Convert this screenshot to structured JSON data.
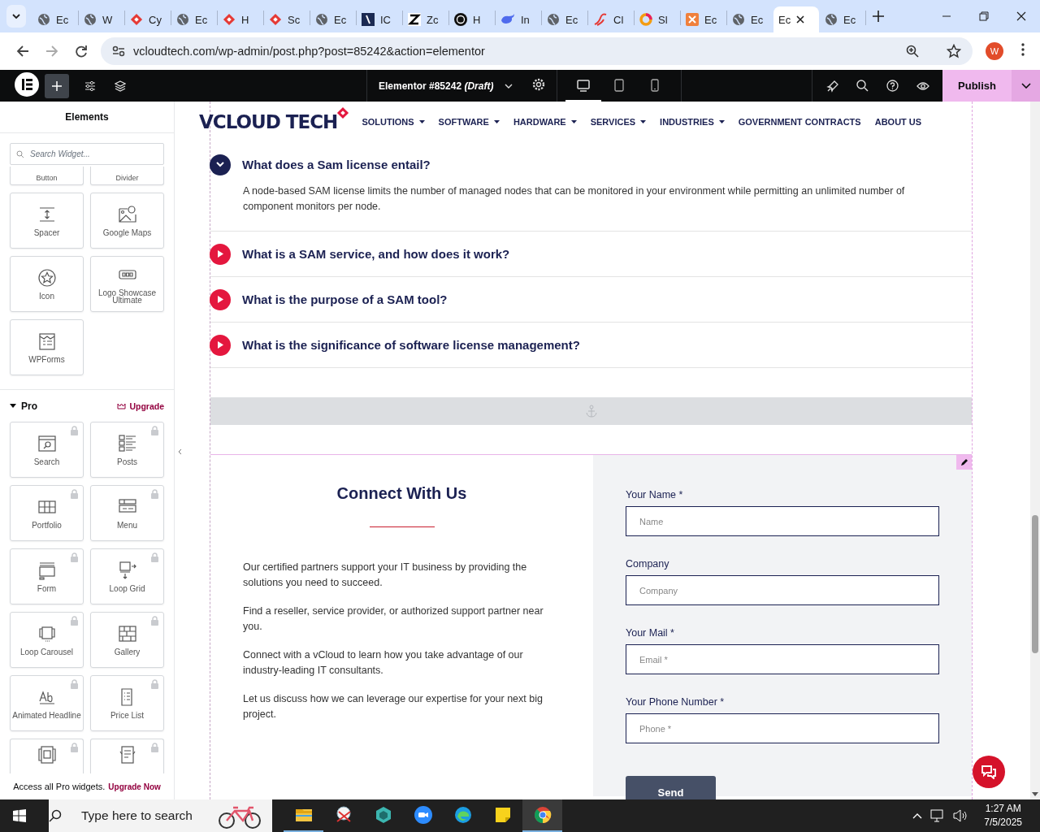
{
  "browser": {
    "tabs": [
      {
        "label": "Ec",
        "kind": "globe",
        "selected": false
      },
      {
        "label": "W",
        "kind": "globe",
        "selected": false
      },
      {
        "label": "Cy",
        "kind": "diamond",
        "selected": false
      },
      {
        "label": "Ec",
        "kind": "globe",
        "selected": false
      },
      {
        "label": "H",
        "kind": "diamond",
        "selected": false
      },
      {
        "label": "Sc",
        "kind": "diamond",
        "selected": false
      },
      {
        "label": "Ec",
        "kind": "globe",
        "selected": false
      },
      {
        "label": "IC",
        "kind": "slash",
        "selected": false
      },
      {
        "label": "Zc",
        "kind": "zed",
        "selected": false
      },
      {
        "label": "H",
        "kind": "dark",
        "selected": false
      },
      {
        "label": "In",
        "kind": "whale",
        "selected": false
      },
      {
        "label": "Ec",
        "kind": "globe",
        "selected": false
      },
      {
        "label": "Cl",
        "kind": "swirl",
        "selected": false
      },
      {
        "label": "Sl",
        "kind": "ring",
        "selected": false
      },
      {
        "label": "Ec",
        "kind": "box",
        "selected": false
      },
      {
        "label": "Ec",
        "kind": "globe",
        "selected": false
      },
      {
        "label": "Ec",
        "kind": "none",
        "selected": true
      },
      {
        "label": "Ec",
        "kind": "globe",
        "selected": false
      }
    ],
    "address": "vcloudtech.com/wp-admin/post.php?post=85242&action=elementor",
    "profile": "W"
  },
  "editor_bar": {
    "title": "Elementor #85242 *(Draft)*",
    "devices": [
      {
        "kind": "desktop",
        "selected": true
      },
      {
        "kind": "tablet",
        "selected": false
      },
      {
        "kind": "mobile",
        "selected": false
      }
    ],
    "publish": "Publish"
  },
  "panel": {
    "title": "Elements",
    "search": {
      "placeholder": "Search Widget..."
    },
    "widgets": [
      {
        "label": "Button",
        "kind": "stub"
      },
      {
        "label": "Divider",
        "kind": "stub"
      },
      {
        "label": "Spacer",
        "kind": "spacer"
      },
      {
        "label": "Google Maps",
        "kind": "map"
      },
      {
        "label": "Icon",
        "kind": "star"
      },
      {
        "label": "Logo Showcase Ultimate",
        "kind": "logos"
      },
      {
        "label": "WPForms",
        "kind": "wpforms"
      }
    ],
    "pro": {
      "title": "Pro",
      "expanded": true,
      "upgrade": "Upgrade",
      "widgets": [
        {
          "label": "Search",
          "kind": "search",
          "locked": true
        },
        {
          "label": "Posts",
          "kind": "posts",
          "locked": true
        },
        {
          "label": "Portfolio",
          "kind": "portfolio",
          "locked": true
        },
        {
          "label": "Menu",
          "kind": "menu",
          "locked": true
        },
        {
          "label": "Form",
          "kind": "form",
          "locked": true
        },
        {
          "label": "Loop Grid",
          "kind": "loopgrid",
          "locked": true
        },
        {
          "label": "Loop Carousel",
          "kind": "carousel",
          "locked": true
        },
        {
          "label": "Gallery",
          "kind": "gallery",
          "locked": true
        },
        {
          "label": "Animated Headline",
          "kind": "headline",
          "locked": true
        },
        {
          "label": "Price List",
          "kind": "pricelist",
          "locked": true
        },
        {
          "kind": "pricetable",
          "locked": true
        },
        {
          "kind": "document",
          "locked": true
        }
      ]
    },
    "banner": {
      "text": "Access all Pro widgets.",
      "link": "Upgrade Now"
    }
  },
  "site": {
    "logo": "VCLOUD TECH",
    "menu": [
      {
        "label": "SOLUTIONS",
        "dropdown": true
      },
      {
        "label": "SOFTWARE",
        "dropdown": true
      },
      {
        "label": "HARDWARE",
        "dropdown": true
      },
      {
        "label": "SERVICES",
        "dropdown": true
      },
      {
        "label": "INDUSTRIES",
        "dropdown": true
      },
      {
        "label": "GOVERNMENT CONTRACTS",
        "dropdown": false
      },
      {
        "label": "ABOUT US",
        "dropdown": false
      }
    ],
    "faq": [
      {
        "question": "What does a Sam license entail?",
        "expanded": true,
        "answer": "A node-based SAM license limits the number of managed nodes that can be monitored in your environment while permitting an unlimited number of component monitors per node."
      },
      {
        "question": "What is a SAM service, and how does it work?",
        "expanded": false
      },
      {
        "question": "What is the purpose of a SAM tool?",
        "expanded": false
      },
      {
        "question": "What is the significance of software license management?",
        "expanded": false
      }
    ],
    "contact": {
      "title": "Connect With Us",
      "paragraphs": [
        "Our certified partners support your IT business by providing the solutions you need to succeed.",
        "Find a reseller, service provider, or authorized support partner near you.",
        "Connect with a vCloud to learn how you take advantage of our industry-leading IT consultants.",
        "Let us discuss how we can leverage our expertise for your next big project."
      ],
      "form": {
        "fields": [
          {
            "label": "Your Name *",
            "placeholder": "Name"
          },
          {
            "label": "Company",
            "placeholder": "Company"
          },
          {
            "label": "Your Mail *",
            "placeholder": "Email *"
          },
          {
            "label": "Your Phone Number *",
            "placeholder": "Phone *"
          }
        ],
        "submit": "Send"
      }
    }
  },
  "taskbar": {
    "search": {
      "placeholder": "Type here to search"
    },
    "apps": [
      {
        "kind": "explorer",
        "running": true,
        "selected": false
      },
      {
        "kind": "snip",
        "running": false,
        "selected": false
      },
      {
        "kind": "hex",
        "running": false,
        "selected": false
      },
      {
        "kind": "zoom",
        "running": false,
        "selected": false
      },
      {
        "kind": "edge",
        "running": false,
        "selected": false
      },
      {
        "kind": "notes",
        "running": false,
        "selected": false
      },
      {
        "kind": "chrome",
        "running": true,
        "selected": true
      }
    ],
    "time": "1:27 AM",
    "date": "7/5/2025"
  }
}
